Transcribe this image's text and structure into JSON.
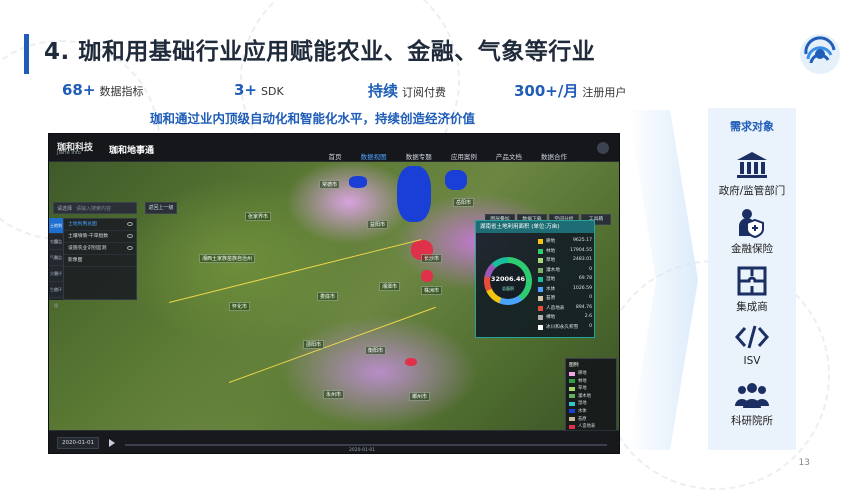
{
  "slide": {
    "title": "4. 珈和用基础行业应用赋能农业、金融、气象等行业",
    "subtitle": "珈和通过业内顶级自动化和智能化水平，持续创造经济价值",
    "page_number": "13",
    "accent_color": "#1f5db8"
  },
  "stats": [
    {
      "value": "68+",
      "label": "数据指标"
    },
    {
      "value": "3+",
      "label": "SDK"
    },
    {
      "value": "持续",
      "label": "订阅付费"
    },
    {
      "value": "300+/月",
      "label": "注册用户"
    }
  ],
  "app": {
    "brand": "珈和科技",
    "brand_en": "JiaHe Info",
    "name": "珈和地事通",
    "nav": [
      "首页",
      "数据视图",
      "数据专题",
      "应用案例",
      "产品文档",
      "数据合作"
    ],
    "nav_active": "数据视图",
    "search": {
      "select": "请选择",
      "placeholder": "请输入搜索内容"
    },
    "back_button": "返回上一级",
    "side_tabs": [
      "土地利用",
      "农业监测",
      "气象监测",
      "灾害评估",
      "生态环境"
    ],
    "layers": [
      {
        "label": "土地利用总图"
      },
      {
        "label": "土壤墒情-干旱指数"
      },
      {
        "label": "设施农业识别监测"
      },
      {
        "label": "影像图"
      }
    ],
    "tools": [
      "图层叠加",
      "数据下载",
      "空间分析",
      "工具箱"
    ],
    "stat_panel": {
      "title": "湖南省土地利用面积 (单位:万亩)",
      "total": "32006.46",
      "total_label": "总面积",
      "categories": [
        {
          "name": "耕地",
          "value": "9625.17",
          "color": "#f1c40f"
        },
        {
          "name": "林地",
          "value": "17904.55",
          "color": "#2ecc71"
        },
        {
          "name": "草地",
          "value": "2483.01",
          "color": "#a3d977"
        },
        {
          "name": "灌木地",
          "value": "0",
          "color": "#7fb069"
        },
        {
          "name": "湿地",
          "value": "69.78",
          "color": "#1abc9c"
        },
        {
          "name": "水体",
          "value": "1026.59",
          "color": "#4aa3ff"
        },
        {
          "name": "苔原",
          "value": "0",
          "color": "#d7c7a8"
        },
        {
          "name": "人造地表",
          "value": "894.76",
          "color": "#e74c3c"
        },
        {
          "name": "裸地",
          "value": "2.6",
          "color": "#b0b0b0"
        },
        {
          "name": "冰川和永久积雪",
          "value": "0",
          "color": "#ffffff"
        }
      ]
    },
    "legend": {
      "title": "图例",
      "items": [
        {
          "name": "耕地",
          "color": "#f2a7e8"
        },
        {
          "name": "林地",
          "color": "#2ea043"
        },
        {
          "name": "草地",
          "color": "#9fd86b"
        },
        {
          "name": "灌木地",
          "color": "#5fb35f"
        },
        {
          "name": "湿地",
          "color": "#36c6c9"
        },
        {
          "name": "水体",
          "color": "#1a3fd6"
        },
        {
          "name": "苔原",
          "color": "#c9b99a"
        },
        {
          "name": "人造地表",
          "color": "#e0314a"
        },
        {
          "name": "裸地",
          "color": "#9a9a9a"
        },
        {
          "name": "冰川和永久积雪",
          "color": "#ffffff"
        }
      ]
    },
    "timeline": {
      "date": "2020-01-01",
      "tick_date": "2020-01-01"
    },
    "places": [
      "常德市",
      "岳阳市",
      "益阳市",
      "长沙市",
      "湘潭市",
      "株洲市",
      "娄底市",
      "邵阳市",
      "怀化市",
      "衡阳市",
      "永州市",
      "郴州市",
      "张家界市",
      "湘西土家族苗族自治州"
    ]
  },
  "demand": {
    "title": "需求对象",
    "items": [
      {
        "label": "政府/监管部门",
        "icon": "government-building-icon"
      },
      {
        "label": "金融保险",
        "icon": "insurance-shield-person-icon"
      },
      {
        "label": "集成商",
        "icon": "integration-puzzle-icon"
      },
      {
        "label": "ISV",
        "icon": "code-brackets-icon"
      },
      {
        "label": "科研院所",
        "icon": "research-group-icon"
      }
    ]
  }
}
